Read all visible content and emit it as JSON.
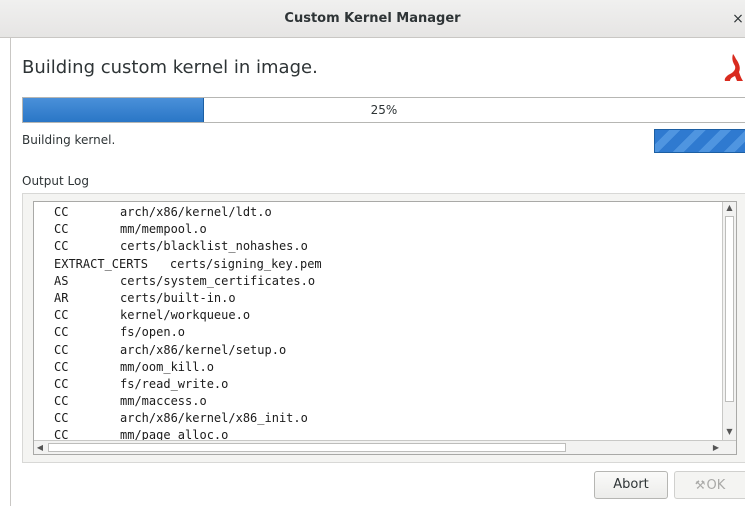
{
  "window": {
    "title": "Custom Kernel Manager",
    "close_glyph": "×"
  },
  "header": {
    "heading": "Building custom kernel in image.",
    "logo_icon": "red-brand-logo-icon"
  },
  "progress": {
    "value": 0.25,
    "label": "25%",
    "fill_color": "#2f7ad0"
  },
  "status": {
    "text": "Building kernel."
  },
  "log": {
    "label": "Output Log",
    "lines": [
      {
        "tag": "CC",
        "path": "arch/x86/kernel/ldt.o"
      },
      {
        "tag": "CC",
        "path": "mm/mempool.o"
      },
      {
        "tag": "CC",
        "path": "certs/blacklist_nohashes.o"
      },
      {
        "tag": "EXTRACT_CERTS",
        "path": "certs/signing_key.pem"
      },
      {
        "tag": "AS",
        "path": "certs/system_certificates.o"
      },
      {
        "tag": "AR",
        "path": "certs/built-in.o"
      },
      {
        "tag": "CC",
        "path": "kernel/workqueue.o"
      },
      {
        "tag": "CC",
        "path": "fs/open.o"
      },
      {
        "tag": "CC",
        "path": "arch/x86/kernel/setup.o"
      },
      {
        "tag": "CC",
        "path": "mm/oom_kill.o"
      },
      {
        "tag": "CC",
        "path": "fs/read_write.o"
      },
      {
        "tag": "CC",
        "path": "mm/maccess.o"
      },
      {
        "tag": "CC",
        "path": "arch/x86/kernel/x86_init.o"
      },
      {
        "tag": "CC",
        "path": "mm/page_alloc.o"
      }
    ]
  },
  "buttons": {
    "abort": "Abort",
    "ok": "OK",
    "ok_icon": "wrench-icon"
  }
}
